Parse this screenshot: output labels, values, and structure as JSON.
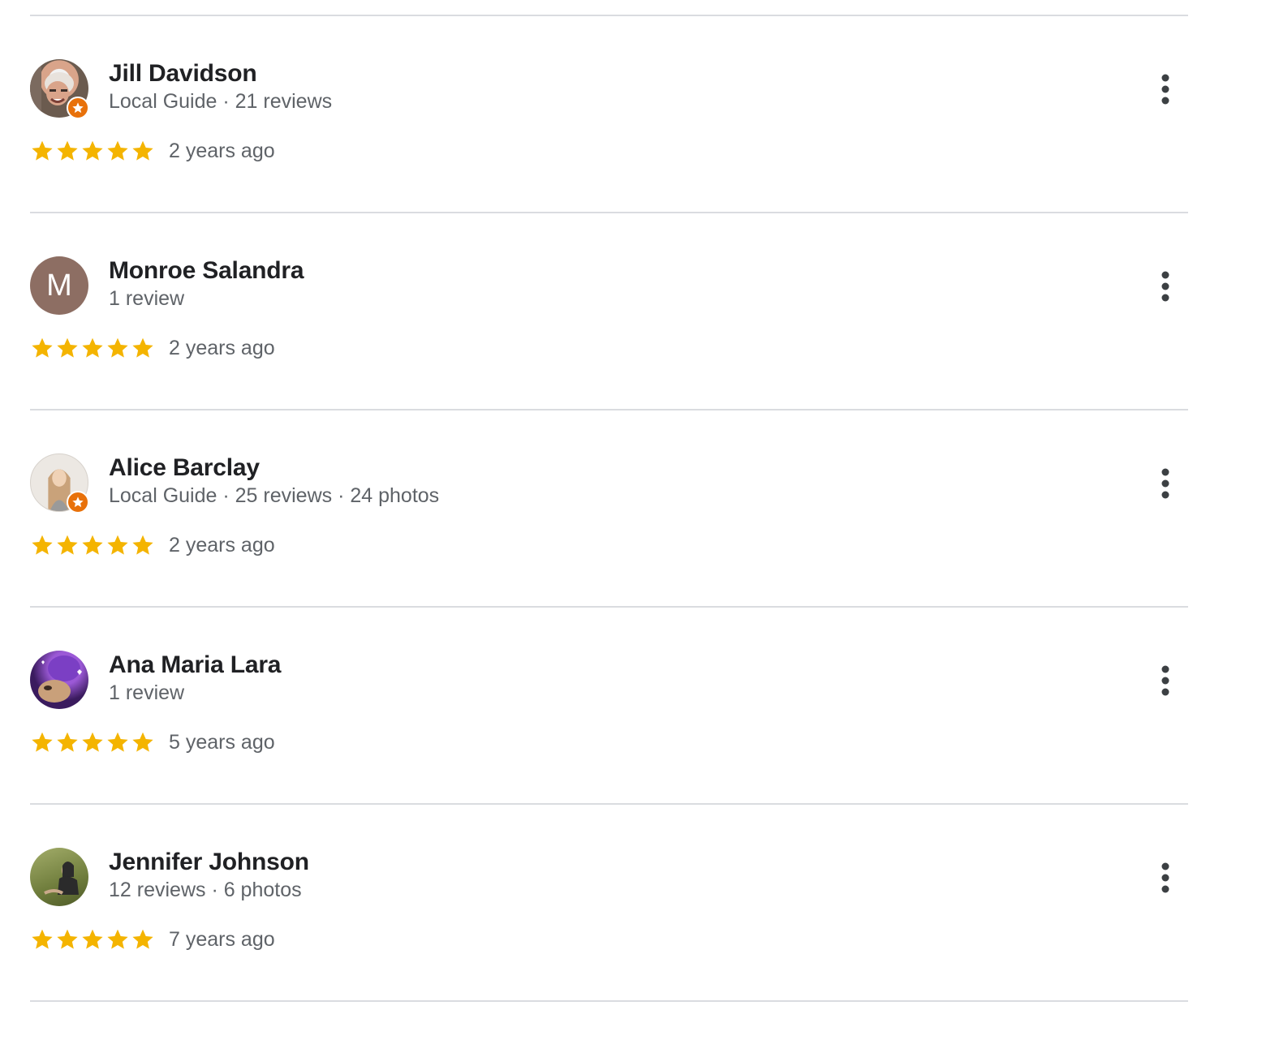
{
  "reviews": [
    {
      "name": "Jill Davidson",
      "meta": "Local Guide · 21 reviews",
      "local_guide": true,
      "avatar": {
        "kind": "photo",
        "icon": "user-photo",
        "colors": [
          "#6b5b4f",
          "#e8d7c9",
          "#d9a48a",
          "#f2f2f2"
        ]
      },
      "rating": 5,
      "time": "2 years ago"
    },
    {
      "name": "Monroe Salandra",
      "meta": "1 review",
      "local_guide": false,
      "avatar": {
        "kind": "letter",
        "letter": "M",
        "color": "#8d6e63"
      },
      "rating": 5,
      "time": "2 years ago"
    },
    {
      "name": "Alice Barclay",
      "meta": "Local Guide · 25 reviews · 24 photos",
      "local_guide": true,
      "avatar": {
        "kind": "photo",
        "icon": "user-photo",
        "colors": [
          "#e9e6e1",
          "#c9a27a",
          "#9a9a9a",
          "#f4efe9"
        ]
      },
      "rating": 5,
      "time": "2 years ago"
    },
    {
      "name": "Ana Maria Lara",
      "meta": "1 review",
      "local_guide": false,
      "avatar": {
        "kind": "photo",
        "icon": "user-photo",
        "colors": [
          "#3a1b5e",
          "#7b3fc4",
          "#c9a07a",
          "#e8c8a0"
        ]
      },
      "rating": 5,
      "time": "5 years ago"
    },
    {
      "name": "Jennifer Johnson",
      "meta": "12 reviews · 6 photos",
      "local_guide": false,
      "avatar": {
        "kind": "photo",
        "icon": "user-photo",
        "colors": [
          "#6f7d3c",
          "#a3ad6a",
          "#2b2b2b",
          "#c9a98a"
        ]
      },
      "rating": 5,
      "time": "7 years ago"
    }
  ],
  "colors": {
    "star": "#f4b400",
    "divider": "#dadce0",
    "name": "#202124",
    "meta": "#5f6368",
    "local_guide_badge": "#e8710a",
    "more_icon": "#5f6368"
  },
  "icons": {
    "star": "star-icon",
    "more": "more-vert-icon",
    "badge": "local-guide-badge-icon"
  }
}
